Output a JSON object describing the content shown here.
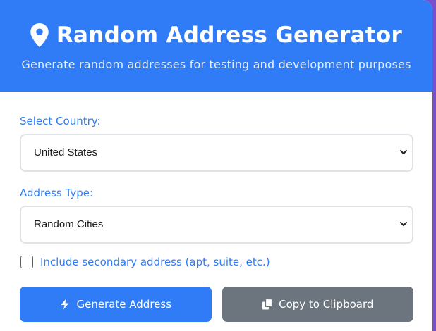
{
  "header": {
    "title": "Random Address Generator",
    "subtitle": "Generate random addresses for testing and development purposes",
    "icon": "map-pin-icon"
  },
  "form": {
    "country": {
      "label": "Select Country:",
      "selected": "United States"
    },
    "address_type": {
      "label": "Address Type:",
      "selected": "Random Cities"
    },
    "secondary": {
      "label": "Include secondary address (apt, suite, etc.)",
      "checked": false
    }
  },
  "buttons": {
    "generate": {
      "label": "Generate Address",
      "icon": "bolt-icon"
    },
    "copy": {
      "label": "Copy to Clipboard",
      "icon": "copy-icon"
    }
  },
  "colors": {
    "primary": "#2f7cf6",
    "secondary": "#6c757d",
    "page_background": "#7a4fc9"
  }
}
